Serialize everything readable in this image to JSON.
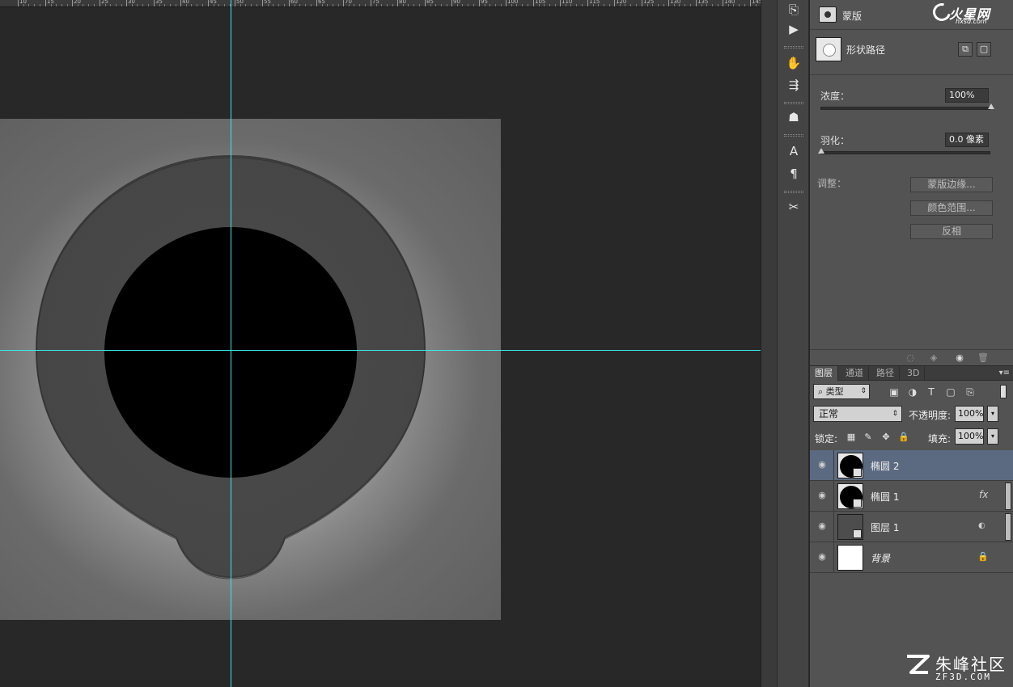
{
  "ruler": {
    "ticks": [
      "10",
      "15",
      "20",
      "25",
      "30",
      "35",
      "40",
      "45",
      "50",
      "55",
      "60",
      "65",
      "70",
      "75",
      "80",
      "85",
      "90",
      "95",
      "100",
      "105",
      "110",
      "115",
      "120",
      "125",
      "130",
      "135",
      "140",
      "145"
    ]
  },
  "colors": {
    "guide": "#3ee6e6",
    "selected_layer": "#5b6a80",
    "panel_bg": "#535353"
  },
  "properties": {
    "title": "蒙版",
    "brand_main": "火星网",
    "brand_sub": "hxsd.com",
    "vector_label": "形状路径",
    "density_label": "浓度：",
    "density_value": "100%",
    "density_level": 1.0,
    "feather_label": "羽化：",
    "feather_value": "0.0 像素",
    "feather_level": 0.0,
    "adjust_label": "调整：",
    "buttons": [
      "蒙版边缘...",
      "颜色范围...",
      "反相"
    ]
  },
  "layers_panel": {
    "tabs": [
      "图层",
      "通道",
      "路径",
      "3D"
    ],
    "filter_kind": "类型",
    "blend_mode": "正常",
    "opacity_label": "不透明度:",
    "opacity_value": "100%",
    "lock_label": "锁定:",
    "fill_label": "填充:",
    "fill_value": "100%",
    "layers": [
      {
        "name": "椭圆 2",
        "selected": true
      },
      {
        "name": "椭圆 1",
        "fx": "fx"
      },
      {
        "name": "图层 1"
      },
      {
        "name": "背景",
        "locked": true
      }
    ]
  },
  "watermark": {
    "title": "朱峰社区",
    "sub": "ZF3D.COM"
  }
}
